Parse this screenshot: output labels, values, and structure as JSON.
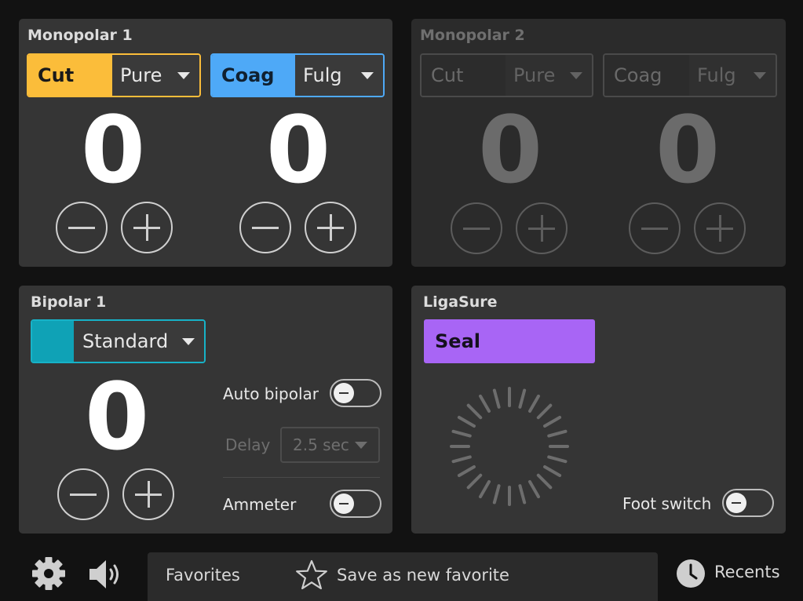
{
  "monopolar1": {
    "title": "Monopolar 1",
    "cut": {
      "label": "Cut",
      "mode": "Pure",
      "value": "0"
    },
    "coag": {
      "label": "Coag",
      "mode": "Fulg",
      "value": "0"
    }
  },
  "monopolar2": {
    "title": "Monopolar 2",
    "cut": {
      "label": "Cut",
      "mode": "Pure",
      "value": "0"
    },
    "coag": {
      "label": "Coag",
      "mode": "Fulg",
      "value": "0"
    }
  },
  "bipolar1": {
    "title": "Bipolar 1",
    "mode": "Standard",
    "value": "0",
    "auto_bipolar_label": "Auto bipolar",
    "auto_bipolar_on": false,
    "delay_label": "Delay",
    "delay_value": "2.5 sec",
    "ammeter_label": "Ammeter",
    "ammeter_on": false
  },
  "ligasure": {
    "title": "LigaSure",
    "seal_label": "Seal",
    "foot_switch_label": "Foot switch",
    "foot_switch_on": false
  },
  "bottom": {
    "favorites_label": "Favorites",
    "save_favorite_label": "Save as new favorite",
    "recents_label": "Recents"
  },
  "colors": {
    "cut": "#fbbd3a",
    "coag": "#4ea9f7",
    "bipolar": "#0fa2b6",
    "seal": "#a865f5"
  },
  "icons": {
    "settings": "gear-icon",
    "volume": "speaker-icon",
    "favorite": "star-icon",
    "recents": "clock-icon"
  }
}
